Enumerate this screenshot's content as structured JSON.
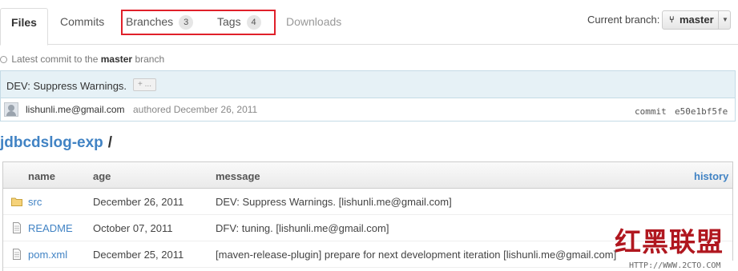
{
  "tabs": {
    "files": "Files",
    "commits": "Commits",
    "branches": "Branches",
    "branches_count": "3",
    "tags": "Tags",
    "tags_count": "4",
    "downloads": "Downloads"
  },
  "branch_selector": {
    "label": "Current branch:",
    "value": "master",
    "icon": "branch-icon",
    "caret": "chevron-down-icon"
  },
  "latest_commit": {
    "prefix": "Latest commit to the",
    "branch": "master",
    "suffix": "branch",
    "message": "DEV: Suppress Warnings.",
    "expander": "+ ...",
    "author": "lishunli.me@gmail.com",
    "authored": "authored December 26, 2011",
    "sha_label": "commit",
    "sha": "e50e1bf5fe"
  },
  "breadcrumb": {
    "repo": "jdbcdslog-exp",
    "separator": "/"
  },
  "file_table": {
    "headers": {
      "name": "name",
      "age": "age",
      "message": "message",
      "history": "history"
    },
    "rows": [
      {
        "icon": "folder-icon",
        "name": "src",
        "age": "December 26, 2011",
        "message": "DEV: Suppress Warnings. [lishunli.me@gmail.com]"
      },
      {
        "icon": "file-icon",
        "name": "README",
        "age": "October 07, 2011",
        "message": "DFV: tuning. [lishunli.me@gmail.com]"
      },
      {
        "icon": "file-icon",
        "name": "pom.xml",
        "age": "December 25, 2011",
        "message": "[maven-release-plugin] prepare for next development iteration [lishunli.me@gmail.com]"
      }
    ]
  },
  "watermark": {
    "logo": "红黑联盟",
    "url": "HTTP://WWW.2CTO.COM"
  },
  "colors": {
    "link": "#4183c4",
    "highlight_border": "#e0202a",
    "commit_bg": "#e6f1f6",
    "watermark": "#b0171f"
  }
}
